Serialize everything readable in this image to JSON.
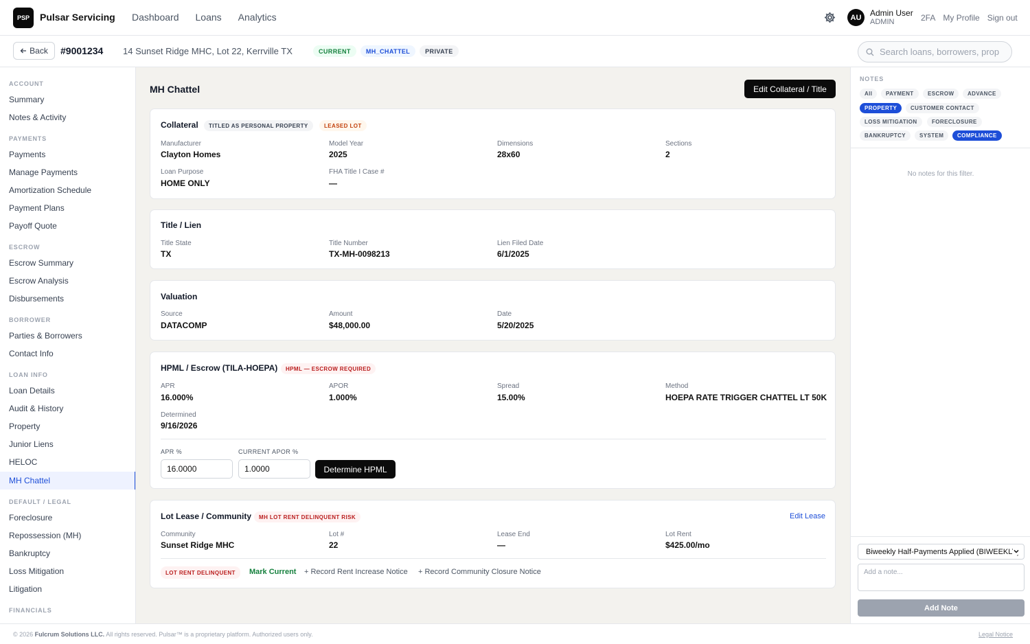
{
  "app": {
    "logo": "PSP",
    "name": "Pulsar Servicing"
  },
  "nav": [
    "Dashboard",
    "Loans",
    "Analytics"
  ],
  "user": {
    "initials": "AU",
    "name": "Admin User",
    "role": "ADMIN",
    "links": [
      "2FA",
      "My Profile",
      "Sign out"
    ]
  },
  "loan": {
    "back": "Back",
    "id": "#9001234",
    "address": "14 Sunset Ridge MHC, Lot 22, Kerrville TX",
    "badges": [
      "CURRENT",
      "MH_CHATTEL",
      "PRIVATE"
    ]
  },
  "search": {
    "placeholder": "Search loans, borrowers, prop"
  },
  "sidebar": [
    {
      "header": "ACCOUNT",
      "items": [
        "Summary",
        "Notes & Activity"
      ]
    },
    {
      "header": "PAYMENTS",
      "items": [
        "Payments",
        "Manage Payments",
        "Amortization Schedule",
        "Payment Plans",
        "Payoff Quote"
      ]
    },
    {
      "header": "ESCROW",
      "items": [
        "Escrow Summary",
        "Escrow Analysis",
        "Disbursements"
      ]
    },
    {
      "header": "BORROWER",
      "items": [
        "Parties & Borrowers",
        "Contact Info"
      ]
    },
    {
      "header": "LOAN INFO",
      "items": [
        "Loan Details",
        "Audit & History",
        "Property",
        "Junior Liens",
        "HELOC",
        "MH Chattel"
      ]
    },
    {
      "header": "DEFAULT / LEGAL",
      "items": [
        "Foreclosure",
        "Repossession (MH)",
        "Bankruptcy",
        "Loss Mitigation",
        "Litigation"
      ]
    },
    {
      "header": "FINANCIALS",
      "items": []
    }
  ],
  "main": {
    "title": "MH Chattel",
    "edit_button": "Edit Collateral / Title",
    "collateral": {
      "title": "Collateral",
      "chips": [
        "TITLED AS PERSONAL PROPERTY",
        "LEASED LOT"
      ],
      "fields": [
        {
          "label": "Manufacturer",
          "value": "Clayton Homes"
        },
        {
          "label": "Model Year",
          "value": "2025"
        },
        {
          "label": "Dimensions",
          "value": "28x60"
        },
        {
          "label": "Sections",
          "value": "2"
        },
        {
          "label": "Loan Purpose",
          "value": "HOME ONLY"
        },
        {
          "label": "FHA Title I Case #",
          "value": "—"
        }
      ]
    },
    "title_lien": {
      "title": "Title / Lien",
      "fields": [
        {
          "label": "Title State",
          "value": "TX"
        },
        {
          "label": "Title Number",
          "value": "TX-MH-0098213"
        },
        {
          "label": "Lien Filed Date",
          "value": "6/1/2025"
        }
      ]
    },
    "valuation": {
      "title": "Valuation",
      "fields": [
        {
          "label": "Source",
          "value": "DATACOMP"
        },
        {
          "label": "Amount",
          "value": "$48,000.00"
        },
        {
          "label": "Date",
          "value": "5/20/2025"
        }
      ]
    },
    "hpml": {
      "title": "HPML / Escrow (TILA-HOEPA)",
      "chip": "HPML — ESCROW REQUIRED",
      "fields": [
        {
          "label": "APR",
          "value": "16.000%"
        },
        {
          "label": "APOR",
          "value": "1.000%"
        },
        {
          "label": "Spread",
          "value": "15.00%"
        },
        {
          "label": "Method",
          "value": "HOEPA RATE TRIGGER CHATTEL LT 50K"
        },
        {
          "label": "Determined",
          "value": "9/16/2026"
        }
      ],
      "apr_label": "APR %",
      "apr_value": "16.0000",
      "apor_label": "CURRENT APOR %",
      "apor_value": "1.0000",
      "button": "Determine HPML"
    },
    "lot_lease": {
      "title": "Lot Lease / Community",
      "chip": "MH LOT RENT DELINQUENT RISK",
      "edit_link": "Edit Lease",
      "fields": [
        {
          "label": "Community",
          "value": "Sunset Ridge MHC"
        },
        {
          "label": "Lot #",
          "value": "22"
        },
        {
          "label": "Lease End",
          "value": "—"
        },
        {
          "label": "Lot Rent",
          "value": "$425.00/mo"
        }
      ],
      "status_chip": "LOT RENT DELINQUENT",
      "actions": [
        "Mark Current",
        "+ Record Rent Increase Notice",
        "+ Record Community Closure Notice"
      ]
    }
  },
  "notes": {
    "header": "NOTES",
    "filters": [
      "All",
      "PAYMENT",
      "ESCROW",
      "ADVANCE",
      "PROPERTY",
      "CUSTOMER CONTACT",
      "LOSS MITIGATION",
      "FORECLOSURE",
      "BANKRUPTCY",
      "SYSTEM",
      "COMPLIANCE"
    ],
    "empty": "No notes for this filter.",
    "template_selected": "Biweekly Half-Payments Applied (BIWEEKLY)",
    "placeholder": "Add a note...",
    "add_button": "Add Note"
  },
  "footer": {
    "year_text": "© 2026",
    "company": "Fulcrum Solutions LLC.",
    "rest": "All rights reserved. Pulsar™ is a proprietary platform. Authorized users only.",
    "legal": "Legal Notice"
  },
  "colors": {
    "accent": "#1d4ed8",
    "dark": "#0b0b0b",
    "success": "#15803d",
    "danger": "#b91c1c"
  }
}
